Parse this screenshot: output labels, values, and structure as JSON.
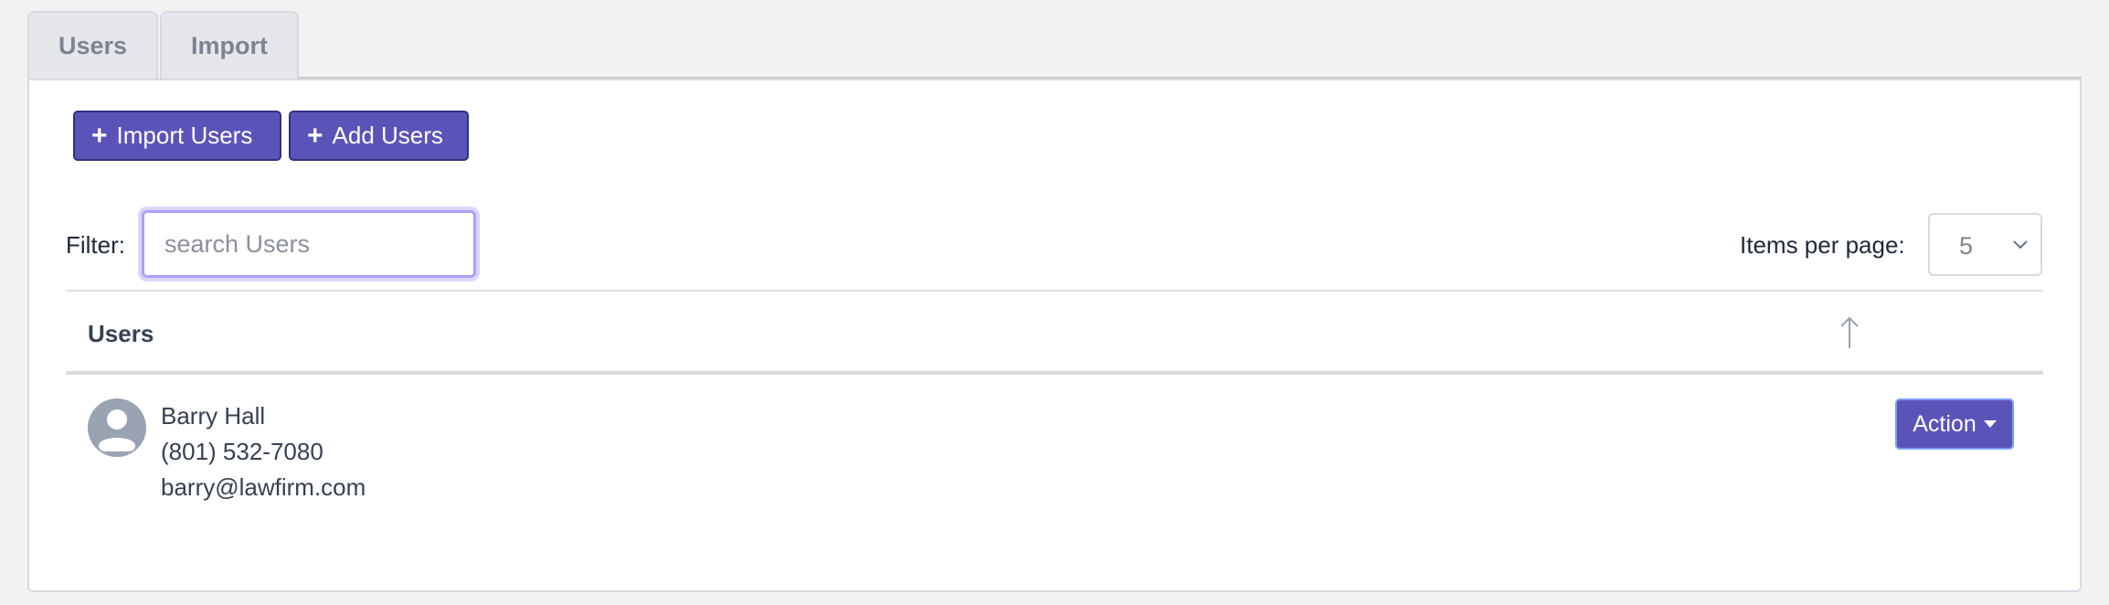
{
  "tabs": [
    {
      "label": "Users",
      "active": true
    },
    {
      "label": "Import",
      "active": false
    }
  ],
  "toolbar": {
    "import_label": "Import Users",
    "add_label": "Add Users",
    "plus_glyph": "+"
  },
  "filter": {
    "label": "Filter:",
    "placeholder": "search Users",
    "value": ""
  },
  "pagination": {
    "label": "Items per page:",
    "selected": "5"
  },
  "table": {
    "column_header": "Users",
    "sort_icon": "arrow-up-icon",
    "rows": [
      {
        "avatar_icon": "user-avatar-icon",
        "name": "Barry Hall",
        "phone": "(801) 532-7080",
        "email": "barry@lawfirm.com",
        "action_label": "Action"
      }
    ]
  },
  "colors": {
    "primary": "#5b54b8",
    "focus_ring": "#a9a0f2",
    "background": "#f2f2f3"
  }
}
